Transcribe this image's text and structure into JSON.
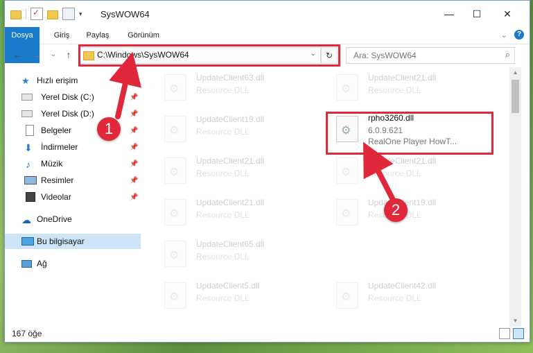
{
  "window": {
    "title": "SysWOW64",
    "controls": {
      "minimize": "—",
      "maximize": "☐",
      "close": "✕"
    }
  },
  "ribbon": {
    "tabs": [
      "Dosya",
      "Giriş",
      "Paylaş",
      "Görünüm"
    ],
    "expand_icon": "chevron-down-icon",
    "help": "?"
  },
  "nav": {
    "back": "←",
    "forward": "→",
    "recent": "⌄",
    "up": "↑",
    "address": "C:\\Windows\\SysWOW64",
    "address_dropdown": "⌄",
    "refresh": "↻",
    "search_placeholder": "Ara: SysWOW64",
    "search_icon": "⌕"
  },
  "sidebar": {
    "items": [
      {
        "label": "Hızlı erişim",
        "icon": "star-icon",
        "pinned": false
      },
      {
        "label": "Yerel Disk (C:)",
        "icon": "drive-icon",
        "pinned": true
      },
      {
        "label": "Yerel Disk (D:)",
        "icon": "drive-icon",
        "pinned": true
      },
      {
        "label": "Belgeler",
        "icon": "documents-icon",
        "pinned": true
      },
      {
        "label": "İndirmeler",
        "icon": "download-icon",
        "pinned": true
      },
      {
        "label": "Müzik",
        "icon": "music-icon",
        "pinned": true
      },
      {
        "label": "Resimler",
        "icon": "pictures-icon",
        "pinned": true
      },
      {
        "label": "Videolar",
        "icon": "video-icon",
        "pinned": true
      },
      {
        "label": "OneDrive",
        "icon": "cloud-icon",
        "pinned": false
      },
      {
        "label": "Bu bilgisayar",
        "icon": "computer-icon",
        "pinned": false,
        "selected": true
      },
      {
        "label": "Ağ",
        "icon": "network-icon",
        "pinned": false
      }
    ],
    "pin_glyph": "📌"
  },
  "files": {
    "left_column": [
      {
        "name": "UpdateClient63.dll",
        "type": "Resource DLL"
      },
      {
        "name": "UpdateClient19.dll",
        "type": "Resource DLL"
      },
      {
        "name": "UpdateClient21.dll",
        "type": "Resource DLL"
      },
      {
        "name": "UpdateClient21.dll",
        "type": "Resource DLL"
      },
      {
        "name": "UpdateClient65.dll",
        "type": "Resource DLL"
      },
      {
        "name": "UpdateClient5.dll",
        "type": "Resource DLL"
      }
    ],
    "right_column": [
      {
        "name": "UpdateClient21.dll",
        "type": "Resource DLL"
      },
      {
        "name": "UpdateClient21.dll",
        "type": "Resource DLL"
      },
      {
        "name": "UpdateClient19.dll",
        "type": "Resource DLL"
      },
      {
        "name": "UpdateClient42.dll",
        "type": "Resource DLL"
      }
    ],
    "highlighted": {
      "name": "rpho3260.dll",
      "version": "6.0.9.621",
      "description": "RealOne Player HowT..."
    }
  },
  "status": {
    "count": "167 öğe"
  },
  "callouts": {
    "one": "1",
    "two": "2",
    "color": "#e0283a"
  }
}
